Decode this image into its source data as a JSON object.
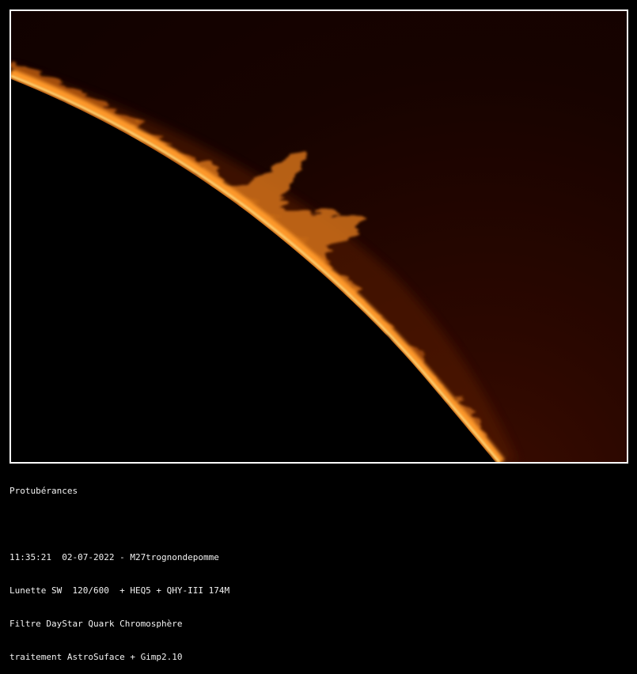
{
  "image": {
    "subject": "sun-limb-icon",
    "colors": {
      "sky_dark": "#120200",
      "sky_glow": "#2a0800",
      "limb_hot": "#ffd070",
      "chromosphere": "#ff9a2a",
      "prominence": "#e07a1e",
      "disk": "#000000"
    }
  },
  "caption": {
    "title": "Protubérances",
    "blank": "",
    "line1": "11:35:21  02-07-2022 - M27trognondepomme",
    "line2": "Lunette SW  120/600  + HEQ5 + QHY-III 174M",
    "line3": "Filtre DayStar Quark Chromosphère",
    "line4": "traitement AstroSuface + Gimp2.10"
  }
}
